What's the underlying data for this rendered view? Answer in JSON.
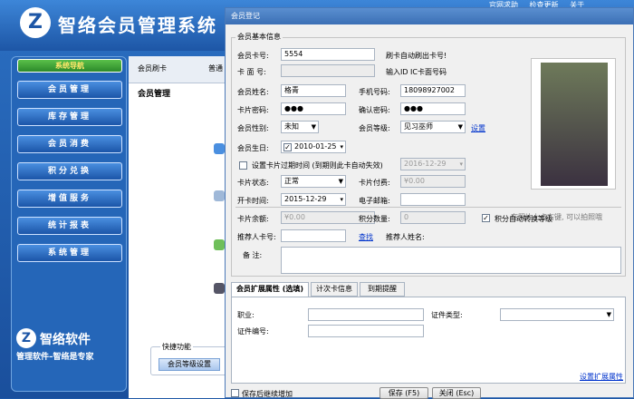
{
  "app": {
    "title": "智络会员管理系统",
    "top_links": [
      "官网求助",
      "检查更新",
      "关于"
    ],
    "nav_header": "系统导航",
    "nav_items": [
      "会员管理",
      "库存管理",
      "会员消费",
      "积分兑换",
      "增值服务",
      "统计报表",
      "系统管理"
    ],
    "brand_name": "智络软件",
    "brand_slogan": "管理软件–智络是专家",
    "toolbar": {
      "member_card": "会员刷卡",
      "general": "普通"
    },
    "main_title": "会员管理",
    "quick_label": "快捷功能",
    "quick_button": "会员等级设置"
  },
  "dialog": {
    "title": "会员登记",
    "group_title": "会员基本信息",
    "card_no_label": "会员卡号:",
    "card_no_value": "5554",
    "card_hint": "刷卡自动刷出卡号!",
    "face_no_label": "卡 面 号:",
    "face_hint": "输入ID IC卡面号码",
    "name_label": "会员姓名:",
    "name_value": "格青",
    "phone_label": "手机号码:",
    "phone_value": "18098927002",
    "password_label": "卡片密码:",
    "password_value": "●●●",
    "confirm_label": "确认密码:",
    "confirm_value": "●●●",
    "gender_label": "会员性别:",
    "gender_value": "未知",
    "level_label": "会员等级:",
    "level_value": "见习巫师",
    "settings_link": "设置",
    "birthday_label": "会员生日:",
    "birthday_value": "2010-01-25",
    "expire_label": "设置卡片过期时间 (到期则此卡自动失效)",
    "expire_value": "2016-12-29",
    "status_label": "卡片状态:",
    "status_value": "正常",
    "fee_label": "卡片付费:",
    "fee_value": "¥0.00",
    "open_label": "开卡时间:",
    "open_value": "2015-12-29",
    "email_label": "电子邮箱:",
    "balance_label": "卡片余额:",
    "balance_value": "¥0.00",
    "points_label": "积分数量:",
    "points_value": "0",
    "auto_level_label": "积分自动转换等级",
    "referrer_label": "推荐人卡号:",
    "find_link": "查找",
    "referrer_name_label": "推荐人姓名:",
    "notes_label": "备 注:",
    "photo_caption": "在照片上点右键, 可以拍照哦",
    "tabs": [
      "会员扩展属性 (选填)",
      "计次卡信息",
      "到期提醒"
    ],
    "job_label": "职业:",
    "id_type_label": "证件类型:",
    "id_no_label": "证件编号:",
    "ext_link": "设置扩展属性",
    "keep_adding_label": "保存后继续增加",
    "save_button": "保存 (F5)",
    "close_button": "关闭 (Esc)"
  }
}
